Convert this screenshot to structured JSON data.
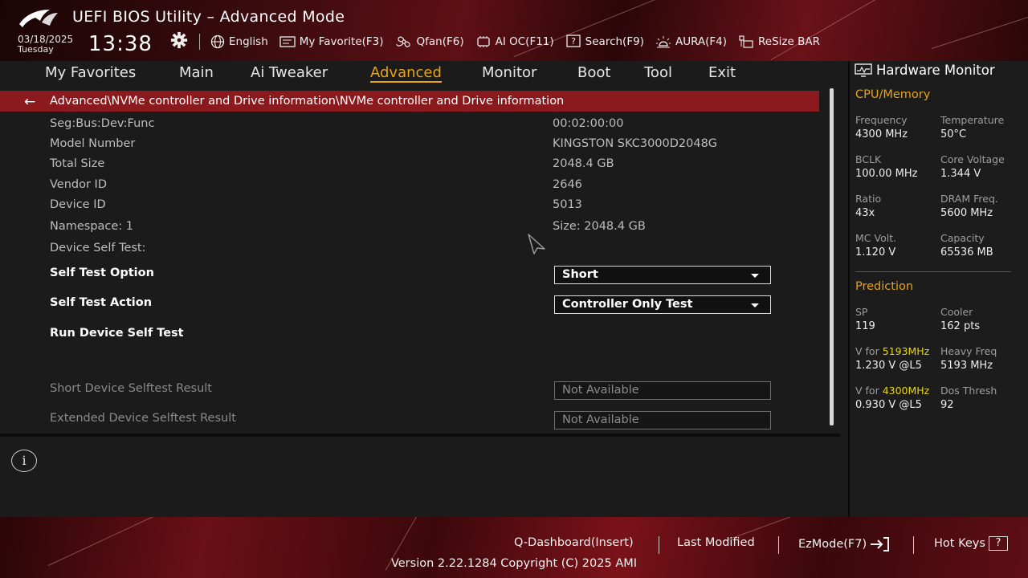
{
  "header": {
    "title": "UEFI BIOS Utility – Advanced Mode",
    "date": "03/18/2025",
    "day": "Tuesday",
    "time": "13:38",
    "toolbar": [
      {
        "label": "English",
        "icon": "globe-icon"
      },
      {
        "label": "My Favorite(F3)",
        "icon": "favorite-list-icon"
      },
      {
        "label": "Qfan(F6)",
        "icon": "fan-icon"
      },
      {
        "label": "AI OC(F11)",
        "icon": "ai-chip-icon"
      },
      {
        "label": "Search(F9)",
        "icon": "search-question-icon"
      },
      {
        "label": "AURA(F4)",
        "icon": "aura-light-icon"
      },
      {
        "label": "ReSize BAR",
        "icon": "resize-bar-icon"
      }
    ]
  },
  "menu": {
    "items": [
      "My Favorites",
      "Main",
      "Ai Tweaker",
      "Advanced",
      "Monitor",
      "Boot",
      "Tool",
      "Exit"
    ],
    "active": "Advanced"
  },
  "breadcrumb": {
    "path": "Advanced\\NVMe controller and Drive information\\NVMe controller and Drive information"
  },
  "info_rows": [
    {
      "label": "Seg:Bus:Dev:Func",
      "value": "00:02:00:00"
    },
    {
      "label": "Model Number",
      "value": "KINGSTON SKC3000D2048G"
    },
    {
      "label": "Total Size",
      "value": "2048.4 GB"
    },
    {
      "label": "Vendor ID",
      "value": "2646"
    },
    {
      "label": "Device ID",
      "value": "5013"
    },
    {
      "label": "Namespace: 1",
      "value": "Size: 2048.4 GB"
    },
    {
      "label": "Device Self Test:",
      "value": ""
    }
  ],
  "settings": {
    "self_test_option": {
      "label": "Self Test Option",
      "value": "Short"
    },
    "self_test_action": {
      "label": "Self Test Action",
      "value": "Controller Only Test"
    },
    "run_self_test": {
      "label": "Run Device Self Test"
    },
    "short_result": {
      "label": "Short Device Selftest Result",
      "value": "Not Available"
    },
    "extended_result": {
      "label": "Extended Device Selftest Result",
      "value": "Not Available"
    }
  },
  "hardware_monitor": {
    "title": "Hardware Monitor",
    "cpu_memory": {
      "heading": "CPU/Memory",
      "frequency": {
        "label": "Frequency",
        "value": "4300 MHz"
      },
      "temperature": {
        "label": "Temperature",
        "value": "50°C"
      },
      "bclk": {
        "label": "BCLK",
        "value": "100.00 MHz"
      },
      "core_voltage": {
        "label": "Core Voltage",
        "value": "1.344 V"
      },
      "ratio": {
        "label": "Ratio",
        "value": "43x"
      },
      "dram_freq": {
        "label": "DRAM Freq.",
        "value": "5600 MHz"
      },
      "mc_volt": {
        "label": "MC Volt.",
        "value": "1.120 V"
      },
      "capacity": {
        "label": "Capacity",
        "value": "65536 MB"
      }
    },
    "prediction": {
      "heading": "Prediction",
      "sp": {
        "label": "SP",
        "value": "119"
      },
      "cooler": {
        "label": "Cooler",
        "value": "162 pts"
      },
      "v_for_1": {
        "label_prefix": "V for ",
        "label_freq": "5193MHz",
        "value": "1.230 V @L5"
      },
      "heavy_freq": {
        "label": "Heavy Freq",
        "value": "5193 MHz"
      },
      "v_for_2": {
        "label_prefix": "V for ",
        "label_freq": "4300MHz",
        "value": "0.930 V @L5"
      },
      "dos_thresh": {
        "label": "Dos Thresh",
        "value": "92"
      }
    }
  },
  "footer": {
    "q_dashboard": "Q-Dashboard(Insert)",
    "last_modified": "Last Modified",
    "ezmode": "EzMode(F7)",
    "hot_keys": "Hot Keys",
    "hot_keys_glyph": "?",
    "version": "Version 2.22.1284 Copyright (C) 2025 AMI"
  },
  "colors": {
    "accent": "#e8a316",
    "breadcrumb_bg": "#8b1a1e",
    "highlight": "#e8d416"
  }
}
